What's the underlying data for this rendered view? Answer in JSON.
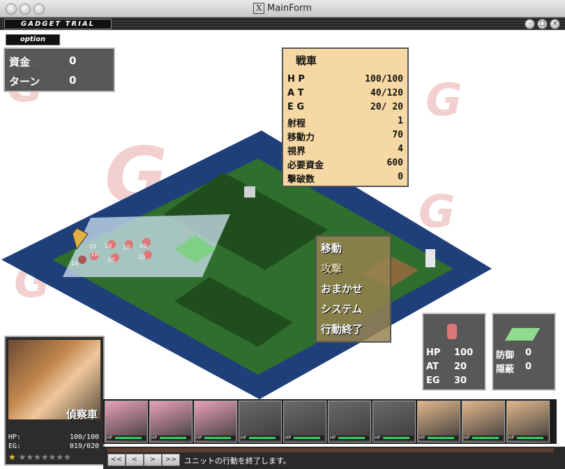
{
  "window": {
    "title": "MainForm",
    "x_glyph": "X"
  },
  "game_title": "GADGET TRIAL",
  "window_buttons": [
    "-",
    "□",
    "×"
  ],
  "option_label": "option",
  "resources": {
    "funds_label": "資金",
    "funds_value": "0",
    "turn_label": "ターン",
    "turn_value": "0"
  },
  "unit_stats": {
    "name": "戦車",
    "rows": [
      {
        "label": "H P",
        "value": "100/100"
      },
      {
        "label": "A T",
        "value": "40/120"
      },
      {
        "label": "E G",
        "value": "20/ 20"
      },
      {
        "label": "射程",
        "value": "1"
      },
      {
        "label": "移動力",
        "value": "70"
      },
      {
        "label": "視界",
        "value": "4"
      },
      {
        "label": "必要資金",
        "value": "600"
      },
      {
        "label": "撃破数",
        "value": "0"
      }
    ]
  },
  "command_menu": [
    "移動",
    "攻撃",
    "おまかせ",
    "システム",
    "行動終了"
  ],
  "unit_panel": {
    "hp_label": "HP",
    "hp_value": "100",
    "at_label": "AT",
    "at_value": "20",
    "eg_label": "EG",
    "eg_value": "30"
  },
  "terrain_panel": {
    "def_label": "防御",
    "def_value": "0",
    "hide_label": "隠蔽",
    "hide_value": "0"
  },
  "map_unit_labels": [
    "10",
    "10",
    "10",
    "10",
    "10",
    "10",
    "10",
    "10"
  ],
  "portrait": {
    "name": "偵察車",
    "hp_label": "HP:",
    "hp_value": "100/100",
    "eg_label": "EG:",
    "eg_value": "019/020",
    "star_icon": "★",
    "rank_stars": "★★★★★★★"
  },
  "roster": {
    "hp_label": "HP",
    "cards": [
      {
        "hp": 0.9,
        "color": "#e9a0b8"
      },
      {
        "hp": 0.9,
        "color": "#e9a0b8"
      },
      {
        "hp": 0.9,
        "color": "#e9a0b8"
      },
      {
        "hp": 0.9,
        "color": "#6a6a6a"
      },
      {
        "hp": 0.9,
        "color": "#6a6a6a"
      },
      {
        "hp": 0.9,
        "color": "#6a6a6a"
      },
      {
        "hp": 0.9,
        "color": "#6a6a6a"
      },
      {
        "hp": 0.9,
        "color": "#e2b68a"
      },
      {
        "hp": 0.9,
        "color": "#e2b68a"
      },
      {
        "hp": 0.9,
        "color": "#e2b68a"
      }
    ]
  },
  "nav_buttons": [
    "<<",
    "<",
    ">",
    ">>"
  ],
  "status_message": "ユニットの行動を終了します。"
}
